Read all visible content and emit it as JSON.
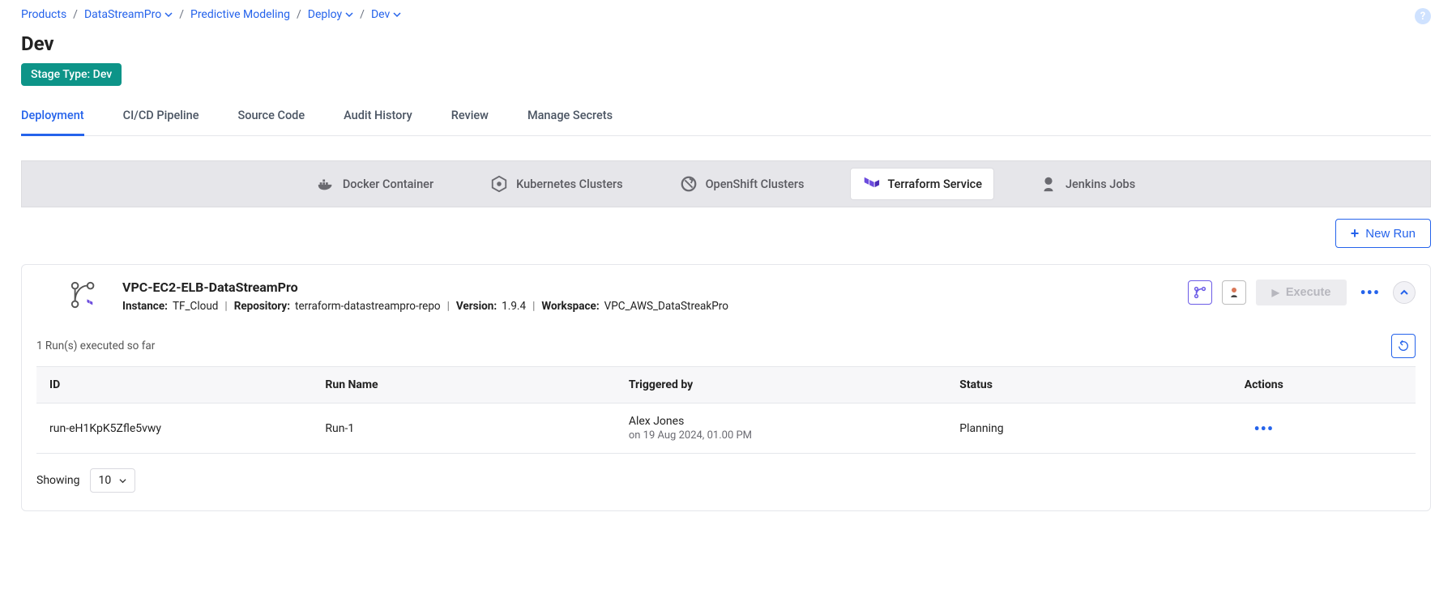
{
  "breadcrumb": {
    "products": "Products",
    "datastream": "DataStreamPro",
    "predictive": "Predictive Modeling",
    "deploy": "Deploy",
    "dev": "Dev"
  },
  "page_title": "Dev",
  "stage_badge": "Stage Type: Dev",
  "tabs": {
    "deployment": "Deployment",
    "cicd": "CI/CD Pipeline",
    "source": "Source Code",
    "audit": "Audit History",
    "review": "Review",
    "secrets": "Manage Secrets"
  },
  "subtabs": {
    "docker": "Docker Container",
    "k8s": "Kubernetes Clusters",
    "openshift": "OpenShift Clusters",
    "terraform": "Terraform Service",
    "jenkins": "Jenkins Jobs"
  },
  "toolbar": {
    "new_run": "New Run"
  },
  "card": {
    "title": "VPC-EC2-ELB-DataStreamPro",
    "instance_label": "Instance:",
    "instance_value": "TF_Cloud",
    "repo_label": "Repository:",
    "repo_value": "terraform-datastreampro-repo",
    "version_label": "Version:",
    "version_value": "1.9.4",
    "workspace_label": "Workspace:",
    "workspace_value": "VPC_AWS_DataStreakPro",
    "execute": "Execute"
  },
  "runs_count": "1 Run(s) executed so far",
  "table": {
    "headers": {
      "id": "ID",
      "name": "Run Name",
      "triggered": "Triggered by",
      "status": "Status",
      "actions": "Actions"
    },
    "rows": [
      {
        "id": "run-eH1KpK5Zfle5vwy",
        "name": "Run-1",
        "triggered_by": "Alex Jones",
        "triggered_on": "on 19 Aug 2024, 01.00 PM",
        "status": "Planning"
      }
    ]
  },
  "pager": {
    "showing": "Showing",
    "size": "10"
  }
}
